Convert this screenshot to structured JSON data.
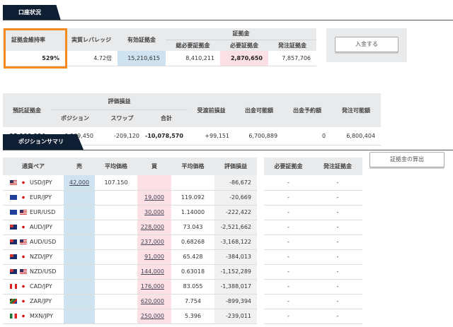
{
  "account": {
    "tab": "口座状況",
    "headers": {
      "margin_ratio": "証拠金維持率",
      "leverage": "実質レバレッジ",
      "effective_margin": "有効証拠金",
      "margin_group": "証拠金",
      "total_required": "総必要証拠金",
      "required": "必要証拠金",
      "order_margin": "発注証拠金"
    },
    "values": {
      "margin_ratio": "529%",
      "leverage": "4.72倍",
      "effective_margin": "15,210,615",
      "total_required": "8,410,211",
      "required": "2,870,650",
      "order_margin": "7,857,706"
    },
    "deposit_button": "入金する",
    "headers2": {
      "deposit": "預託証拠金",
      "valuation_group": "評価損益",
      "position": "ポジション",
      "swap": "スワップ",
      "total": "合計",
      "unsettled": "受渡前損益",
      "withdrawable": "出金可能額",
      "withdraw_reserved": "出金予約額",
      "orderable": "発注可能額"
    },
    "values2": {
      "deposit": "25,190,034",
      "position": "-9,869,450",
      "swap": "-209,120",
      "total": "-10,078,570",
      "unsettled": "+99,151",
      "withdrawable": "6,700,889",
      "withdraw_reserved": "0",
      "orderable": "6,800,404"
    }
  },
  "positions": {
    "tab": "ポジションサマリ",
    "headers": [
      "通貨ペア",
      "売",
      "平均価格",
      "買",
      "平均価格",
      "評価損益"
    ],
    "margin_headers": [
      "必要証拠金",
      "発注証拠金"
    ],
    "calc_button": "証拠金の算出",
    "rows": [
      {
        "f1": "us",
        "f2": "jp",
        "pair": "USD/JPY",
        "sell": "42,000",
        "sell_avg": "107.150",
        "buy": "",
        "buy_avg": "",
        "pl": "-86,672",
        "req": "-",
        "ord": "-"
      },
      {
        "f1": "eu",
        "f2": "jp",
        "pair": "EUR/JPY",
        "sell": "",
        "sell_avg": "",
        "buy": "19,000",
        "buy_avg": "119.092",
        "pl": "-20,669",
        "req": "-",
        "ord": "-"
      },
      {
        "f1": "eu",
        "f2": "us",
        "pair": "EUR/USD",
        "sell": "",
        "sell_avg": "",
        "buy": "30,000",
        "buy_avg": "1.14000",
        "pl": "-222,422",
        "req": "-",
        "ord": "-"
      },
      {
        "f1": "au",
        "f2": "jp",
        "pair": "AUD/JPY",
        "sell": "",
        "sell_avg": "",
        "buy": "228,000",
        "buy_avg": "73.043",
        "pl": "-2,521,662",
        "req": "-",
        "ord": "-"
      },
      {
        "f1": "au",
        "f2": "us",
        "pair": "AUD/USD",
        "sell": "",
        "sell_avg": "",
        "buy": "237,000",
        "buy_avg": "0.68268",
        "pl": "-3,168,122",
        "req": "-",
        "ord": "-"
      },
      {
        "f1": "nz",
        "f2": "jp",
        "pair": "NZD/JPY",
        "sell": "",
        "sell_avg": "",
        "buy": "91,000",
        "buy_avg": "65.428",
        "pl": "-384,013",
        "req": "-",
        "ord": "-"
      },
      {
        "f1": "nz",
        "f2": "us",
        "pair": "NZD/USD",
        "sell": "",
        "sell_avg": "",
        "buy": "144,000",
        "buy_avg": "0.63018",
        "pl": "-1,152,289",
        "req": "-",
        "ord": "-"
      },
      {
        "f1": "ca",
        "f2": "jp",
        "pair": "CAD/JPY",
        "sell": "",
        "sell_avg": "",
        "buy": "176,000",
        "buy_avg": "83.055",
        "pl": "-1,388,017",
        "req": "-",
        "ord": "-"
      },
      {
        "f1": "za",
        "f2": "jp",
        "pair": "ZAR/JPY",
        "sell": "",
        "sell_avg": "",
        "buy": "620,000",
        "buy_avg": "7.754",
        "pl": "-899,394",
        "req": "-",
        "ord": "-"
      },
      {
        "f1": "mx",
        "f2": "jp",
        "pair": "MXN/JPY",
        "sell": "",
        "sell_avg": "",
        "buy": "250,000",
        "buy_avg": "5.396",
        "pl": "-239,011",
        "req": "-",
        "ord": "-"
      }
    ]
  },
  "highlight_color": "#f58a1f"
}
